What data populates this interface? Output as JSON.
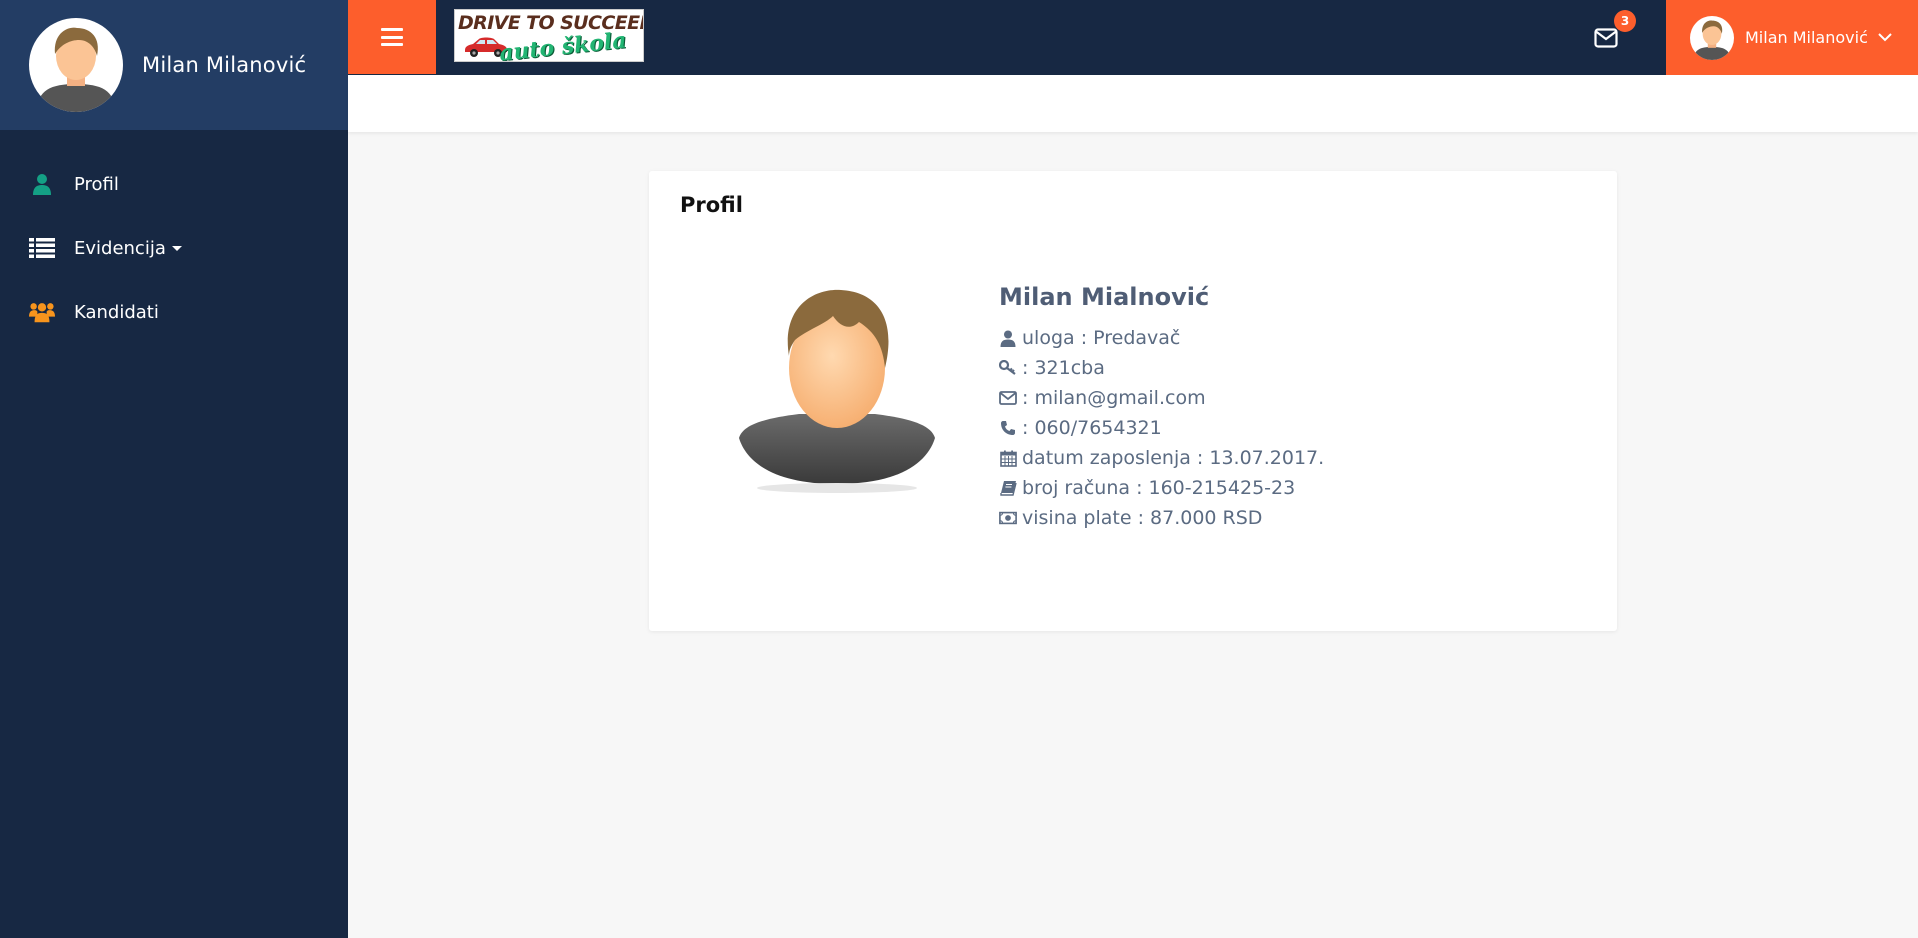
{
  "sidebar": {
    "username": "Milan Milanović",
    "items": [
      {
        "label": "Profil",
        "icon": "user-icon"
      },
      {
        "label": "Evidencija",
        "icon": "list-icon"
      },
      {
        "label": "Kandidati",
        "icon": "users-icon"
      }
    ]
  },
  "topbar": {
    "logo": {
      "line1": "DRIVE TO SUCCEED",
      "line2": "auto škola"
    },
    "mail_count": "3",
    "user_name": "Milan Milanović"
  },
  "card": {
    "title": "Profil",
    "name": "Milan Mialnović",
    "rows": [
      {
        "icon": "user-icon",
        "text": "uloga : Predavač"
      },
      {
        "icon": "key-icon",
        "text": ": 321cba"
      },
      {
        "icon": "envelope-icon",
        "text": ": milan@gmail.com"
      },
      {
        "icon": "phone-icon",
        "text": ": 060/7654321"
      },
      {
        "icon": "calendar-icon",
        "text": "datum zaposlenja : 13.07.2017."
      },
      {
        "icon": "book-icon",
        "text": "broj računa : 160-215425-23"
      },
      {
        "icon": "money-icon",
        "text": "visina plate : 87.000 RSD"
      }
    ]
  },
  "colors": {
    "sidebar_bg": "#172843",
    "sidebar_user_bg": "#233d64",
    "accent": "#fd5e2c",
    "profile_icon": "#14a085",
    "users_icon": "#f7941d",
    "text_muted": "#5b6b82"
  }
}
